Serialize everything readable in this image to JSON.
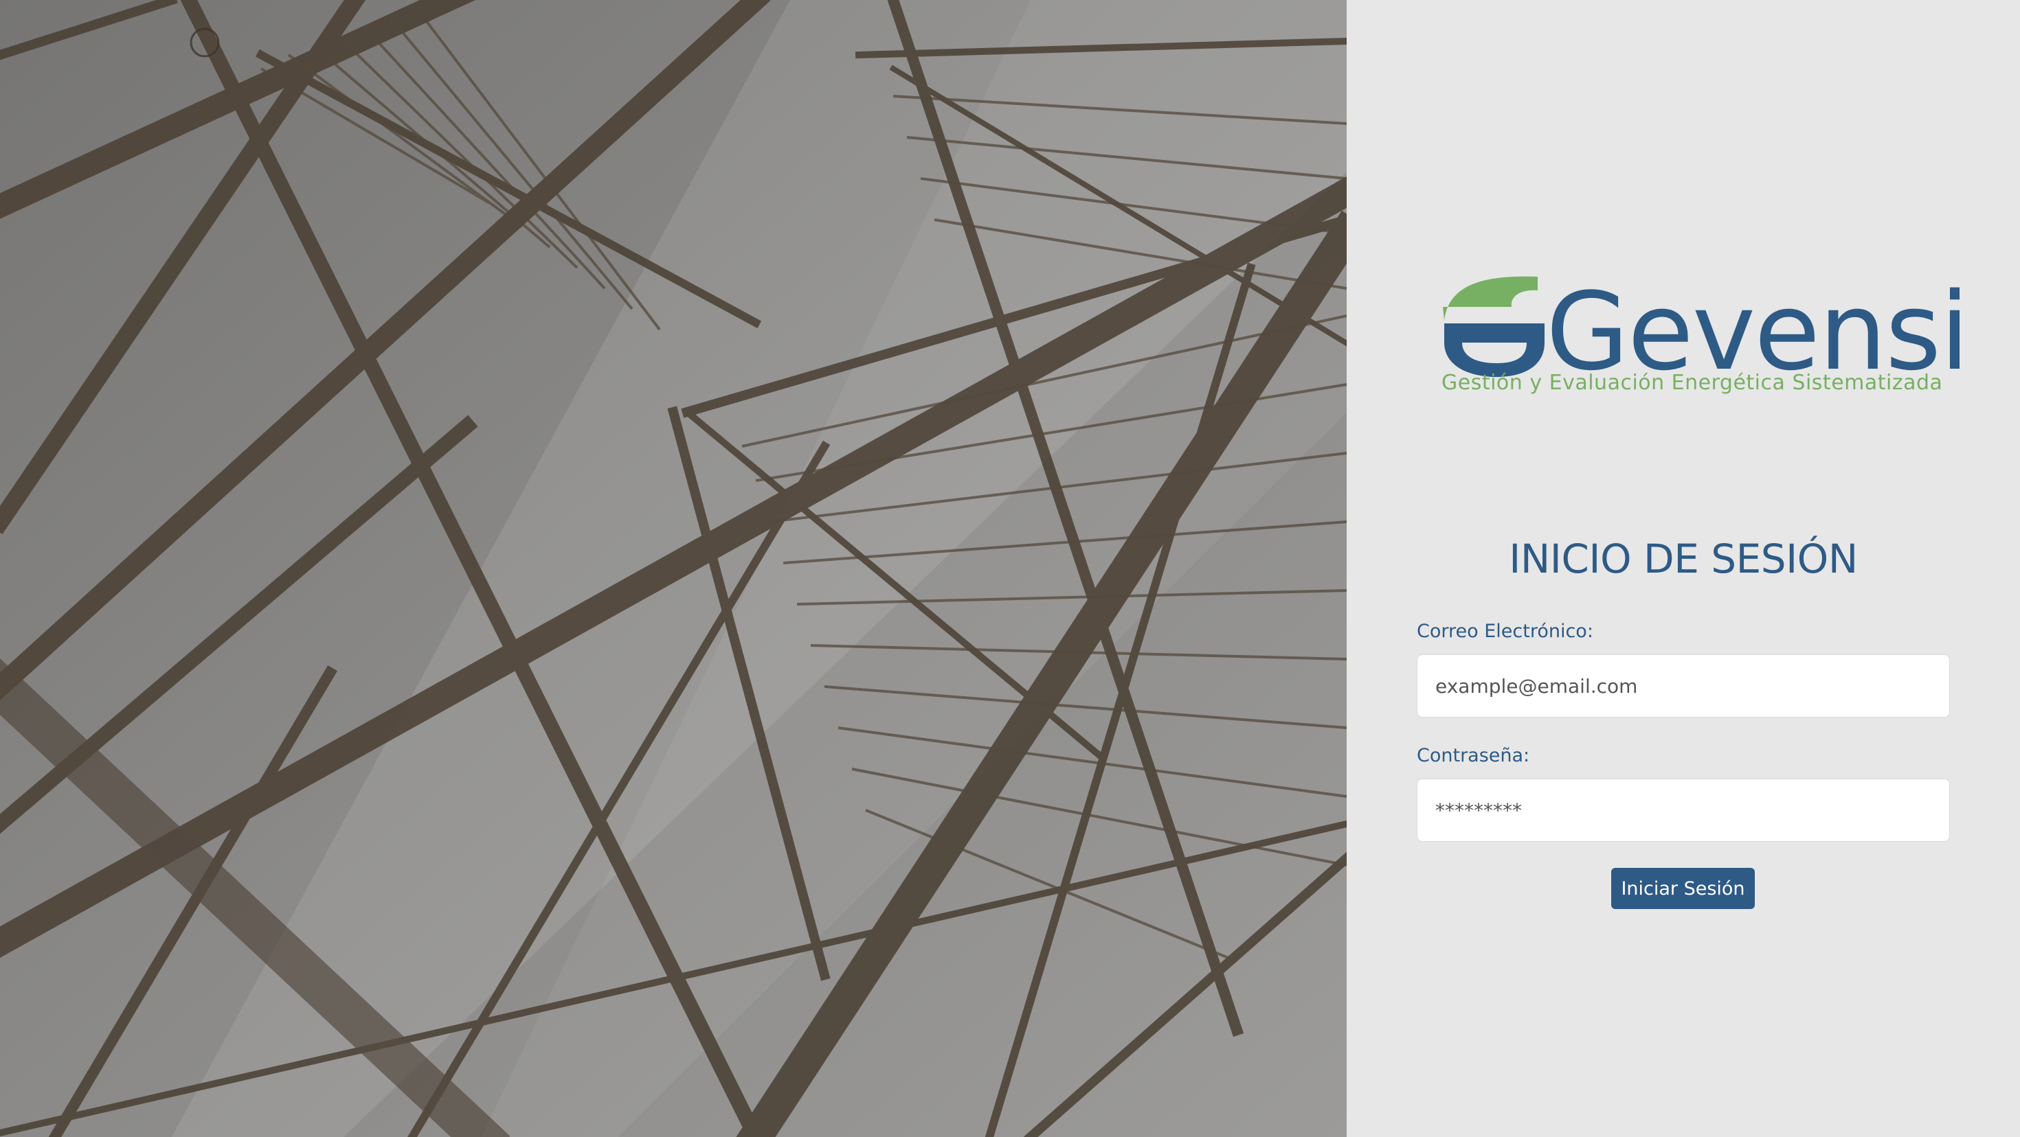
{
  "brand": {
    "name": "Gevensi",
    "tagline": "Gestión y Evaluación Energética Sistematizada",
    "colors": {
      "primary": "#2e5a86",
      "accent": "#77b062",
      "panel_bg": "#e7e7e7"
    }
  },
  "login": {
    "title": "INICIO DE SESIÓN",
    "email_label": "Correo Electrónico:",
    "email_placeholder": "example@email.com",
    "password_label": "Contraseña:",
    "password_value": "*********",
    "submit_label": "Iniciar Sesión"
  },
  "hero": {
    "image_icon": "transmission-tower-photo"
  }
}
